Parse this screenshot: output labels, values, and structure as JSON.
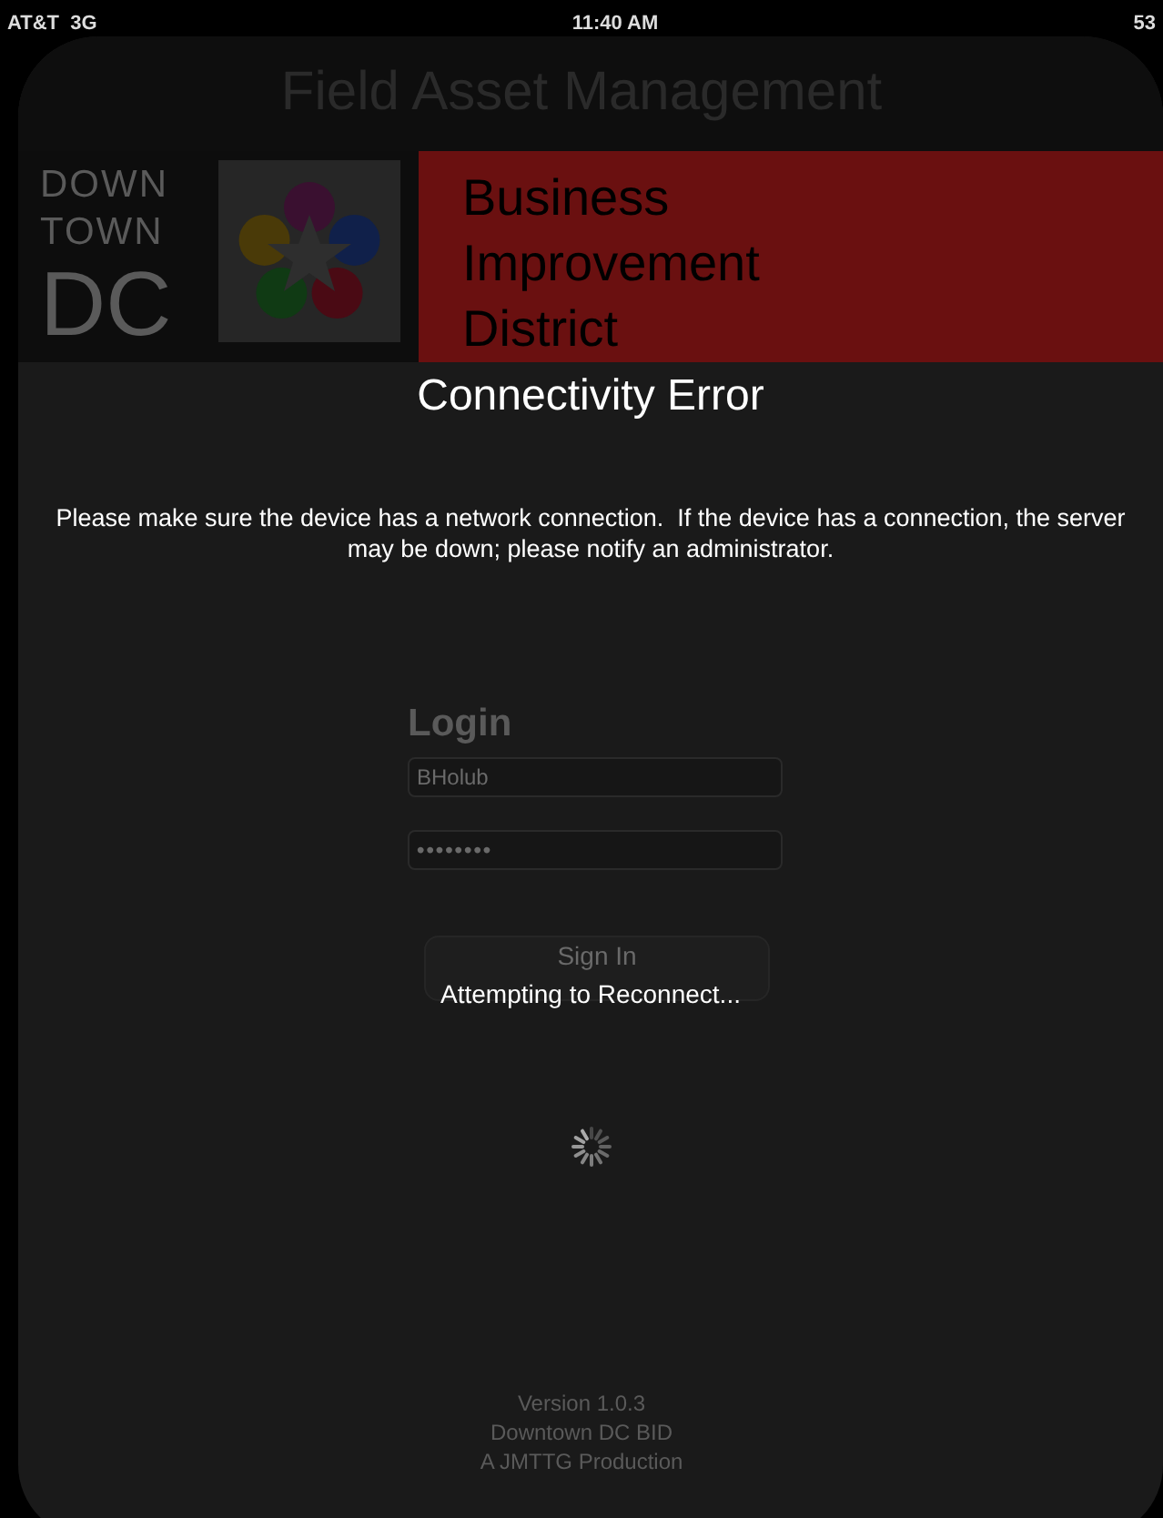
{
  "status_bar": {
    "carrier": "AT&T",
    "network": "3G",
    "time": "11:40 AM",
    "battery": "53"
  },
  "header": {
    "title": "Field Asset Management"
  },
  "banner": {
    "logo_lines": [
      "DOWN",
      "TOWN",
      "DC"
    ],
    "district_lines": [
      "Business",
      "Improvement",
      "District"
    ]
  },
  "login": {
    "heading": "Login",
    "username": "BHolub",
    "password": "••••••••",
    "button": "Sign In"
  },
  "footer": [
    "Version 1.0.3",
    "Downtown DC BID",
    "A JMTTG Production"
  ],
  "alert": {
    "title": "Connectivity Error",
    "message": "Please make sure the device has a network connection.  If the device has a connection, the server may be down; please notify an administrator.",
    "status": "Attempting to Reconnect..."
  }
}
